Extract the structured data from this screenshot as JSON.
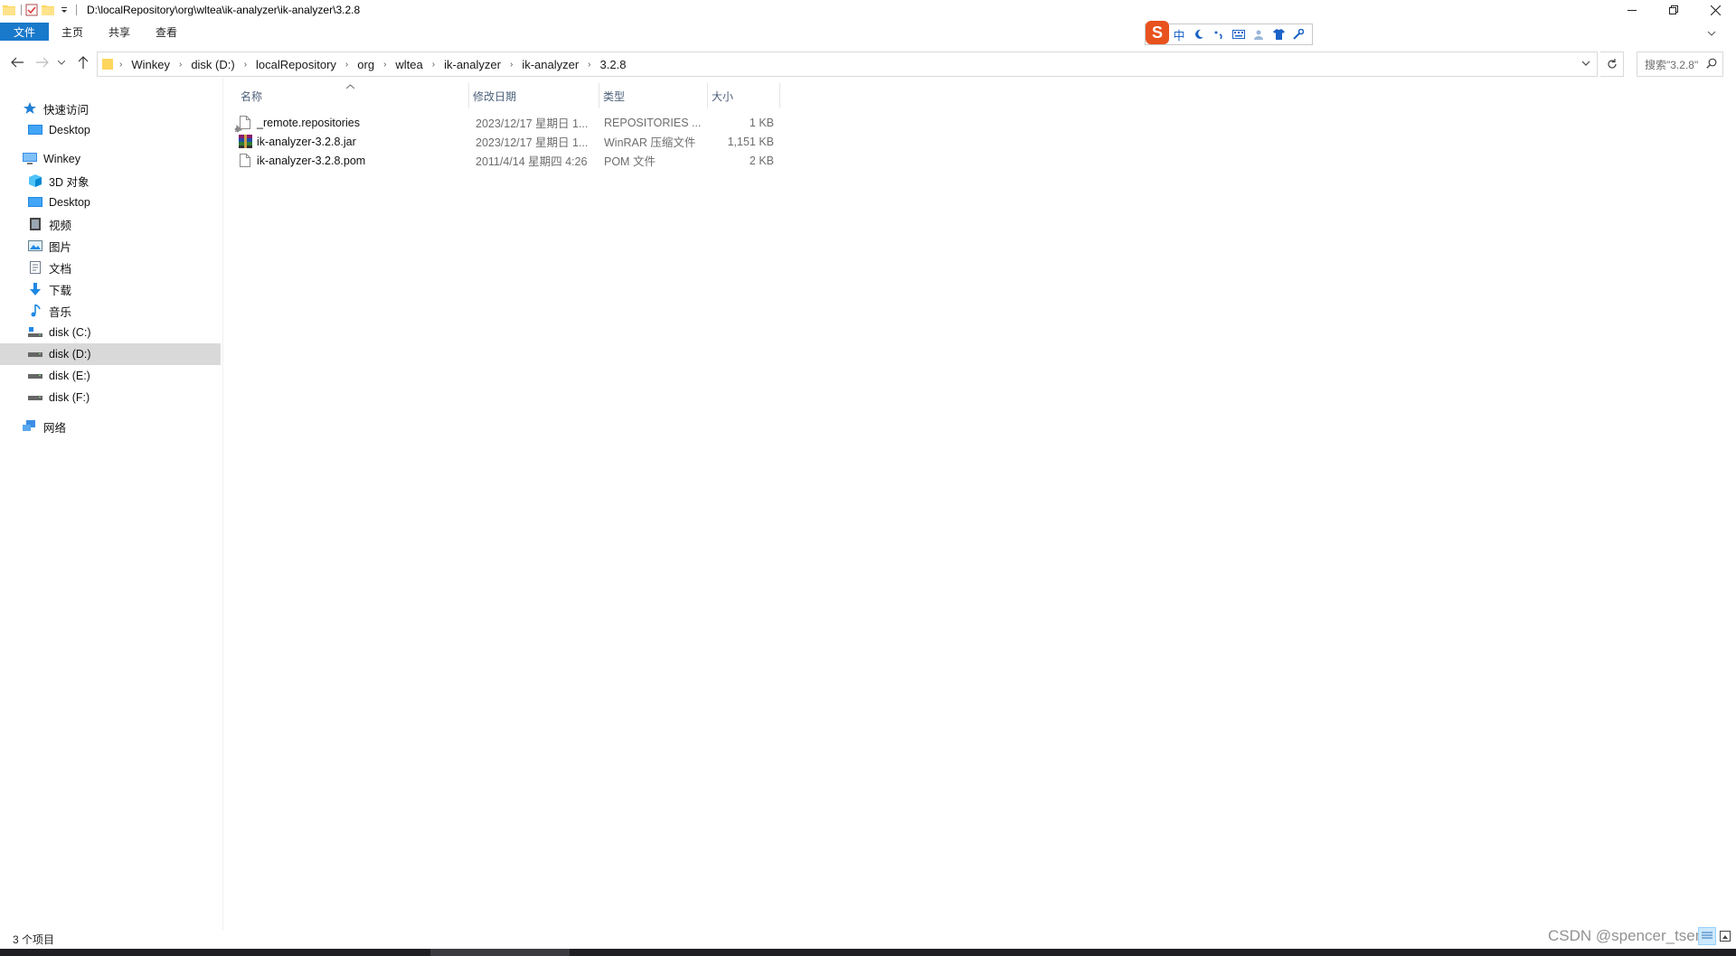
{
  "window": {
    "title_path": "D:\\localRepository\\org\\wltea\\ik-analyzer\\ik-analyzer\\3.2.8"
  },
  "ribbon": {
    "tabs": [
      "文件",
      "主页",
      "共享",
      "查看"
    ]
  },
  "ime": {
    "logo": "S",
    "lang": "中"
  },
  "address": {
    "crumbs": [
      "Winkey",
      "disk (D:)",
      "localRepository",
      "org",
      "wltea",
      "ik-analyzer",
      "ik-analyzer",
      "3.2.8"
    ]
  },
  "search": {
    "placeholder": "搜索\"3.2.8\""
  },
  "nav": {
    "quick_access": "快速访问",
    "quick_items": [
      "Desktop"
    ],
    "this_pc": "Winkey",
    "pc_items": [
      "3D 对象",
      "Desktop",
      "视频",
      "图片",
      "文档",
      "下载",
      "音乐",
      "disk (C:)",
      "disk (D:)",
      "disk (E:)",
      "disk (F:)"
    ],
    "selected": "disk (D:)",
    "network": "网络"
  },
  "columns": [
    "名称",
    "修改日期",
    "类型",
    "大小"
  ],
  "files": [
    {
      "name": "_remote.repositories",
      "date": "2023/12/17 星期日 1...",
      "type": "REPOSITORIES ...",
      "size": "1 KB",
      "icon": "blank-file-icon"
    },
    {
      "name": "ik-analyzer-3.2.8.jar",
      "date": "2023/12/17 星期日 1...",
      "type": "WinRAR 压缩文件",
      "size": "1,151 KB",
      "icon": "winrar-archive-icon"
    },
    {
      "name": "ik-analyzer-3.2.8.pom",
      "date": "2011/4/14 星期四 4:26",
      "type": "POM 文件",
      "size": "2 KB",
      "icon": "blank-file-icon"
    }
  ],
  "status": {
    "count": "3 个项目"
  },
  "watermark": "CSDN @spencer_tseng",
  "colors": {
    "file_tab": "#1979ca",
    "selected_nav": "#d9d9d9",
    "ime_logo": "#e8521d",
    "column_header": "#4c607a"
  }
}
